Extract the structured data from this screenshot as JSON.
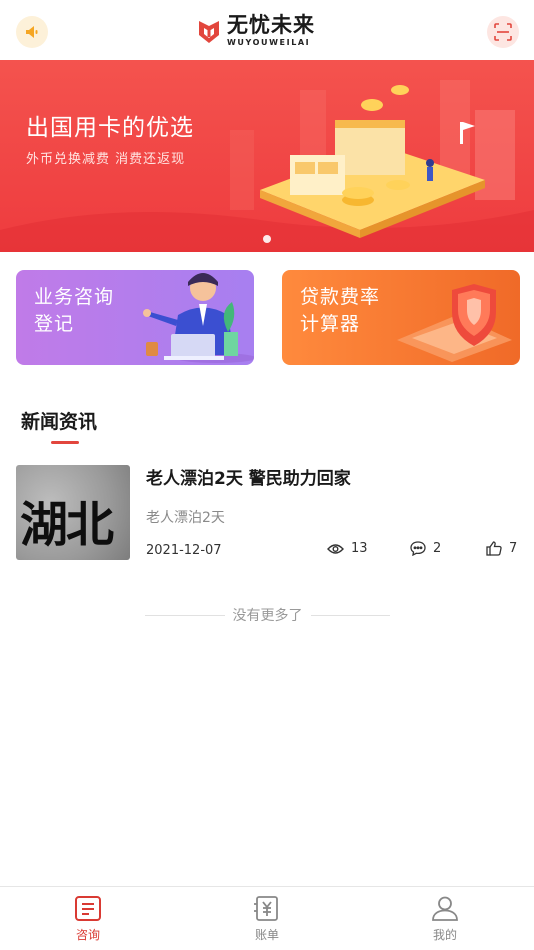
{
  "header": {
    "logo_cn": "无忧未来",
    "logo_en": "WUYOUWEILAI",
    "left_icon": "speaker-icon",
    "right_icon": "scan-icon",
    "accent": "#e2463d"
  },
  "banner": {
    "title": "出国用卡的优选",
    "subtitle": "外币兑换减费 消费还返现",
    "background": "#f0463f",
    "active_slide": 1,
    "slide_count": 1
  },
  "cards": [
    {
      "label_line1": "业务咨询",
      "label_line2": "登记",
      "icon": "consultant-illustration"
    },
    {
      "label_line1": "贷款费率",
      "label_line2": "计算器",
      "icon": "shield-illustration"
    }
  ],
  "news": {
    "section_title": "新闻资讯",
    "items": [
      {
        "thumb_text": "湖北",
        "title": "老人漂泊2天 警民助力回家",
        "summary": "老人漂泊2天",
        "date": "2021-12-07",
        "views": "13",
        "comments": "2",
        "likes": "7"
      }
    ],
    "no_more": "没有更多了"
  },
  "tabbar": {
    "tabs": [
      {
        "label": "咨询",
        "icon": "document-icon",
        "active": true
      },
      {
        "label": "账单",
        "icon": "bill-icon",
        "active": false
      },
      {
        "label": "我的",
        "icon": "user-icon",
        "active": false
      }
    ],
    "active_color": "#d93a33",
    "inactive_color": "#888888"
  }
}
